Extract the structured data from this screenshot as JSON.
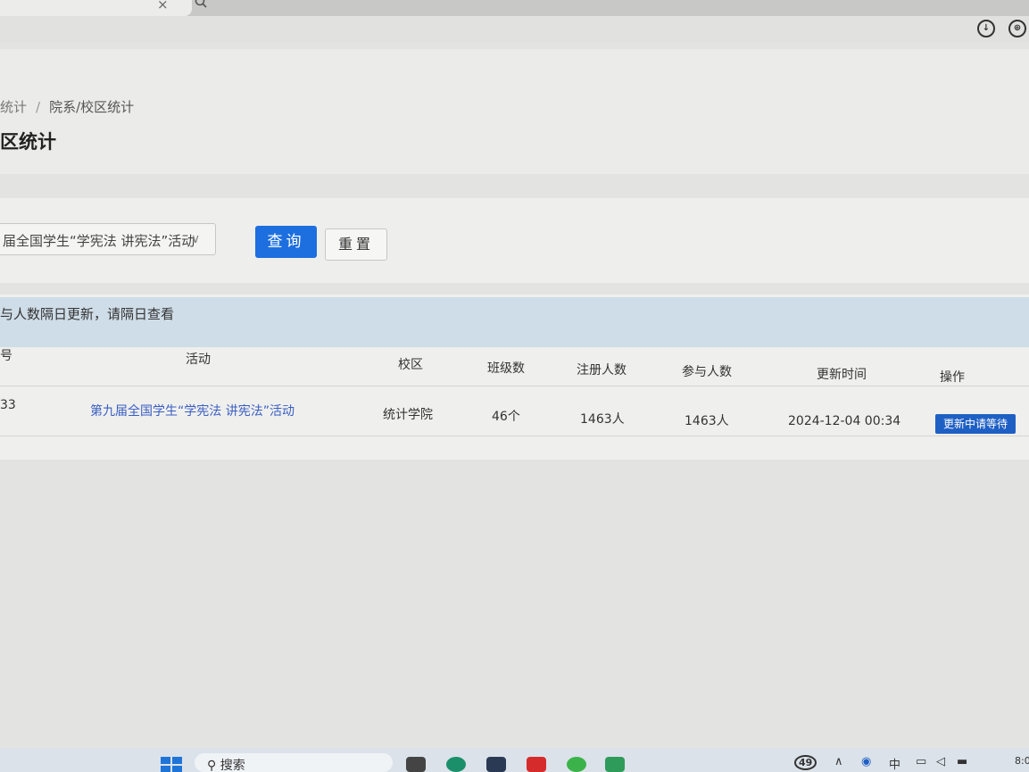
{
  "browser": {
    "tab_close": "×",
    "download_icon": "download-icon",
    "globe_icon": "globe-icon"
  },
  "breadcrumb": {
    "parent": "统计",
    "separator": "/",
    "current": "院系/校区统计"
  },
  "page_title": "区统计",
  "filter": {
    "selected_activity": "届全国学生“学宪法 讲宪法”活动",
    "query_label": "查询",
    "reset_label": "重置"
  },
  "notice": "与人数隔日更新，请隔日查看",
  "table": {
    "headers": [
      "号",
      "活动",
      "校区",
      "班级数",
      "注册人数",
      "参与人数",
      "更新时间",
      "操作"
    ],
    "rows": [
      {
        "id": "33",
        "activity": "第九届全国学生“学宪法 讲宪法”活动",
        "campus": "统计学院",
        "classes": "46个",
        "registered": "1463人",
        "participants": "1463人",
        "updated": "2024-12-04 00:34",
        "action": "更新中请等待"
      }
    ]
  },
  "taskbar": {
    "search_label": "搜索",
    "badge": "49",
    "ime": "中",
    "clock": "8:0"
  },
  "colors": {
    "accent": "#1d6fe0",
    "link": "#3a5fc4",
    "status_bg": "#1e5fc4"
  }
}
